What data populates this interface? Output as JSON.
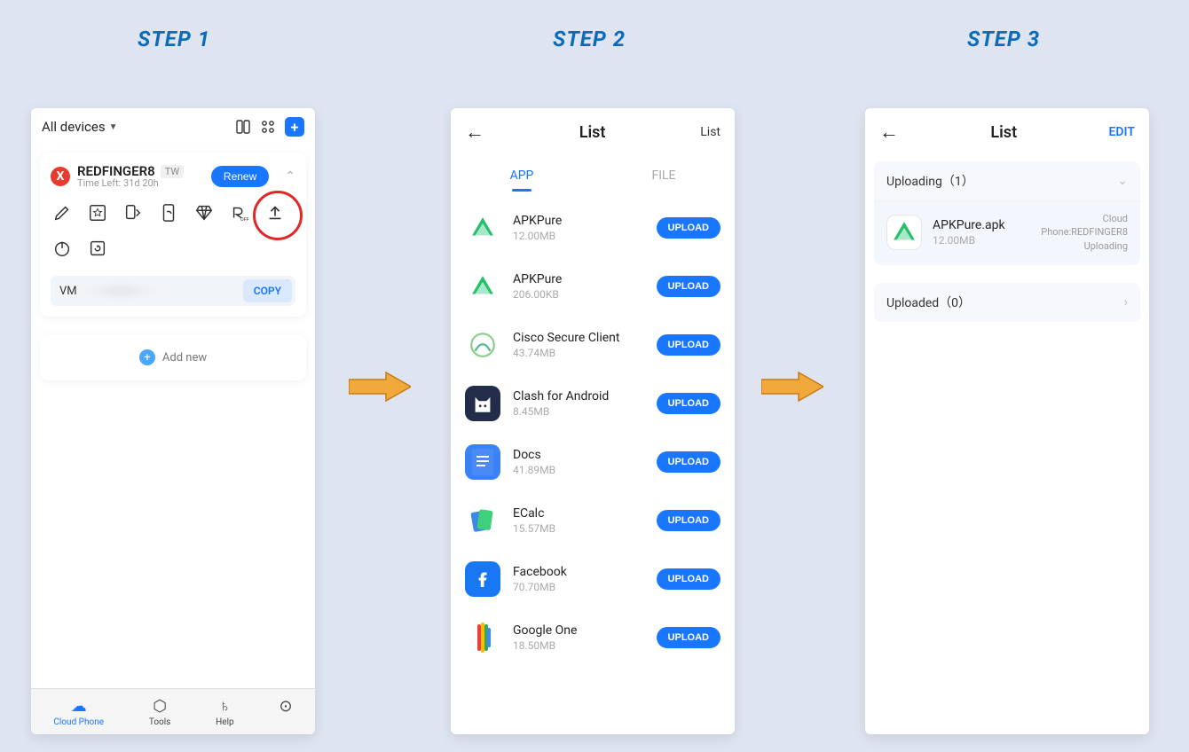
{
  "steps": {
    "s1": "STEP 1",
    "s2": "STEP 2",
    "s3": "STEP 3"
  },
  "step1": {
    "dropdown": "All devices",
    "device_name": "REDFINGER8",
    "region_badge": "TW",
    "renew": "Renew",
    "time_left": "Time Left: 31d 20h",
    "vm_prefix": "VM",
    "copy": "COPY",
    "add_new": "Add new",
    "nav": {
      "cloud": "Cloud Phone",
      "tools": "Tools",
      "help": "Help"
    }
  },
  "step2": {
    "title": "List",
    "right": "List",
    "tab_app": "APP",
    "tab_file": "FILE",
    "upload": "UPLOAD",
    "apps": [
      {
        "name": "APKPure",
        "size": "12.00MB",
        "iconBg": "#fff",
        "iconSvg": "apkpure"
      },
      {
        "name": "APKPure",
        "size": "206.00KB",
        "iconBg": "#fff",
        "iconSvg": "apkpure"
      },
      {
        "name": "Cisco Secure Client",
        "size": "43.74MB",
        "iconBg": "#fff",
        "iconSvg": "cisco"
      },
      {
        "name": "Clash for Android",
        "size": "8.45MB",
        "iconBg": "#222d4a",
        "iconSvg": "cat"
      },
      {
        "name": "Docs",
        "size": "41.89MB",
        "iconBg": "#3b82f6",
        "iconSvg": "docs"
      },
      {
        "name": "ECalc",
        "size": "15.57MB",
        "iconBg": "#fff",
        "iconSvg": "ecalc"
      },
      {
        "name": "Facebook",
        "size": "70.70MB",
        "iconBg": "#1877f2",
        "iconSvg": "fb"
      },
      {
        "name": "Google One",
        "size": "18.50MB",
        "iconBg": "#fff",
        "iconSvg": "gone"
      }
    ]
  },
  "step3": {
    "title": "List",
    "edit": "EDIT",
    "uploading_label": "Uploading（1）",
    "uploaded_label": "Uploaded（0）",
    "item": {
      "name": "APKPure.apk",
      "size": "12.00MB",
      "target": "Cloud Phone:REDFINGER8",
      "status": "Uploading"
    }
  }
}
